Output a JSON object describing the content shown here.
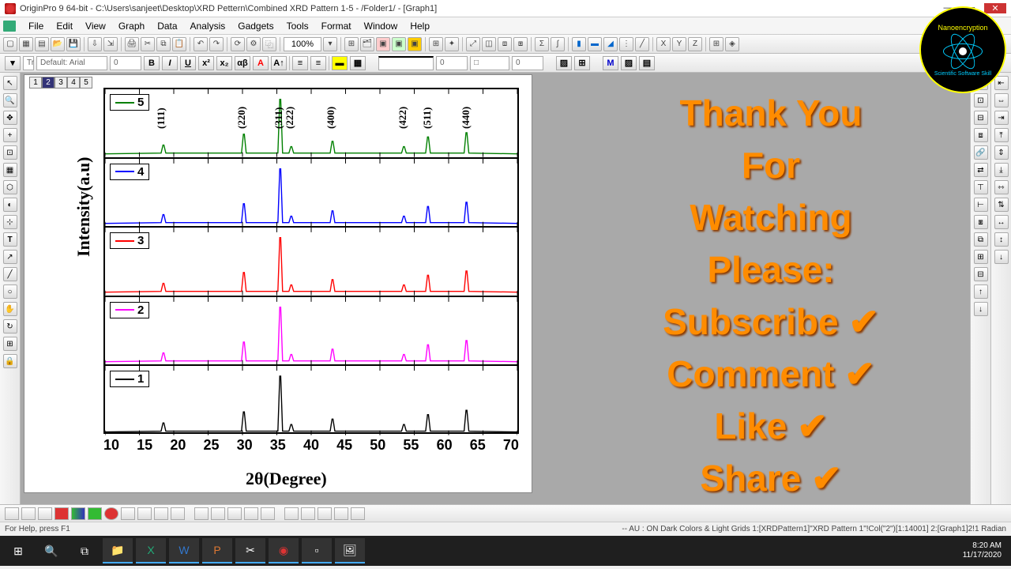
{
  "title": "OriginPro 9 64-bit - C:\\Users\\sanjeet\\Desktop\\XRD Pettern\\Combined XRD Pattern 1-5 - /Folder1/ - [Graph1]",
  "menus": [
    "File",
    "Edit",
    "View",
    "Graph",
    "Data",
    "Analysis",
    "Gadgets",
    "Tools",
    "Format",
    "Window",
    "Help"
  ],
  "zoom": "100%",
  "font_name": "Default: Arial",
  "font_size": "0",
  "layers": [
    "1",
    "2",
    "3",
    "4",
    "5"
  ],
  "active_layer": "2",
  "yaxis": "Intensity(a.u)",
  "xaxis": "2θ(Degree)",
  "xticks": [
    "10",
    "15",
    "20",
    "25",
    "30",
    "35",
    "40",
    "45",
    "50",
    "55",
    "60",
    "65",
    "70"
  ],
  "chart_data": {
    "type": "line",
    "xlabel": "2θ (Degree)",
    "ylabel": "Intensity (a.u)",
    "xlim": [
      10,
      70
    ],
    "series": [
      {
        "name": "1",
        "color": "#000000"
      },
      {
        "name": "2",
        "color": "#ff00ff"
      },
      {
        "name": "3",
        "color": "#ff0000"
      },
      {
        "name": "4",
        "color": "#0000ff"
      },
      {
        "name": "5",
        "color": "#008000"
      }
    ],
    "layout": "stacked_panels_bottom_to_top",
    "peaks_2theta": [
      {
        "hkl": "(111)",
        "x": 18.5
      },
      {
        "hkl": "(220)",
        "x": 30.2
      },
      {
        "hkl": "(311)",
        "x": 35.5
      },
      {
        "hkl": "(222)",
        "x": 37.1
      },
      {
        "hkl": "(400)",
        "x": 43.1
      },
      {
        "hkl": "(422)",
        "x": 53.5
      },
      {
        "hkl": "(511)",
        "x": 57.0
      },
      {
        "hkl": "(440)",
        "x": 62.6
      }
    ],
    "peak_relative_intensity": [
      15,
      35,
      100,
      12,
      22,
      12,
      30,
      38
    ]
  },
  "promo": [
    "Thank You",
    "For",
    "Watching",
    "Please:",
    "Subscribe ✔",
    "Comment ✔",
    "Like ✔",
    "Share ✔"
  ],
  "logo_top": "Nanoencryption",
  "logo_bottom": "Scientific Software Skill",
  "status_left": "For Help, press F1",
  "status_right": "-- AU : ON  Dark Colors & Light Grids  1:[XRDPattern1]\"XRD Pattern 1\"!Col(\"2\")[1:14001]  2:[Graph1]2!1  Radian",
  "clock_time": "8:20 AM",
  "clock_date": "11/17/2020"
}
